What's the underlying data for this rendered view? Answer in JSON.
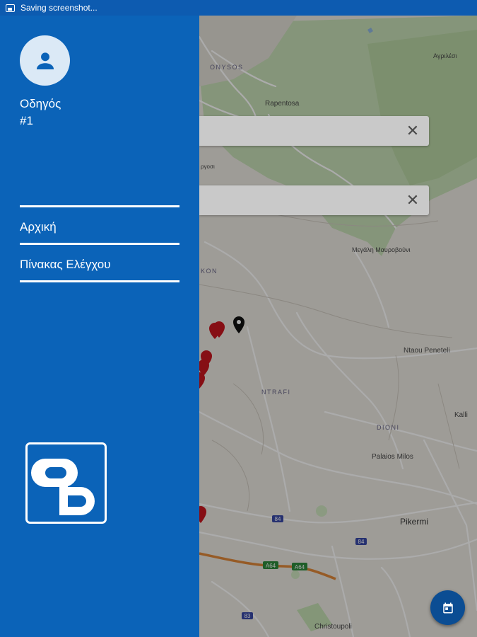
{
  "status_bar": {
    "notification_text": "Saving screenshot..."
  },
  "drawer": {
    "user": {
      "name": "Οδηγός",
      "number": "#1"
    },
    "menu": [
      {
        "label": "Αρχική"
      },
      {
        "label": "Πίνακας Ελέγχου"
      }
    ]
  },
  "map": {
    "place_labels": {
      "dionysos": "ONYSOS",
      "rapentosa": "Rapentosa",
      "agrilesi": "Αγριλέσι",
      "megali_mavrovouni": "Μεγάλη Μαυροβούνι",
      "ntou_peneteli": "Ntaou Peneteli",
      "ntrafi": "NTRAFI",
      "dioni": "DIONI",
      "kallitechnoupoli": "Kalli",
      "palaios_milos": "Palaios Milos",
      "pikermi": "Pikermi",
      "christoupoli": "Christoupoli",
      "kon": "KON",
      "rgosi": "ργοσι"
    },
    "road_shields": {
      "a64_1": "A64",
      "a64_2": "A64",
      "s84_1": "84",
      "s84_2": "84",
      "s83": "83"
    }
  },
  "search_fields": [
    {
      "clear_icon": "close-icon"
    },
    {
      "clear_icon": "close-icon"
    }
  ],
  "fab": {
    "icon": "calendar-icon"
  },
  "colors": {
    "drawer": "#0b63b8",
    "status_bar": "#0d5bb0",
    "fab": "#0b4d93",
    "marker_red": "#c8161e",
    "marker_black": "#111111"
  }
}
